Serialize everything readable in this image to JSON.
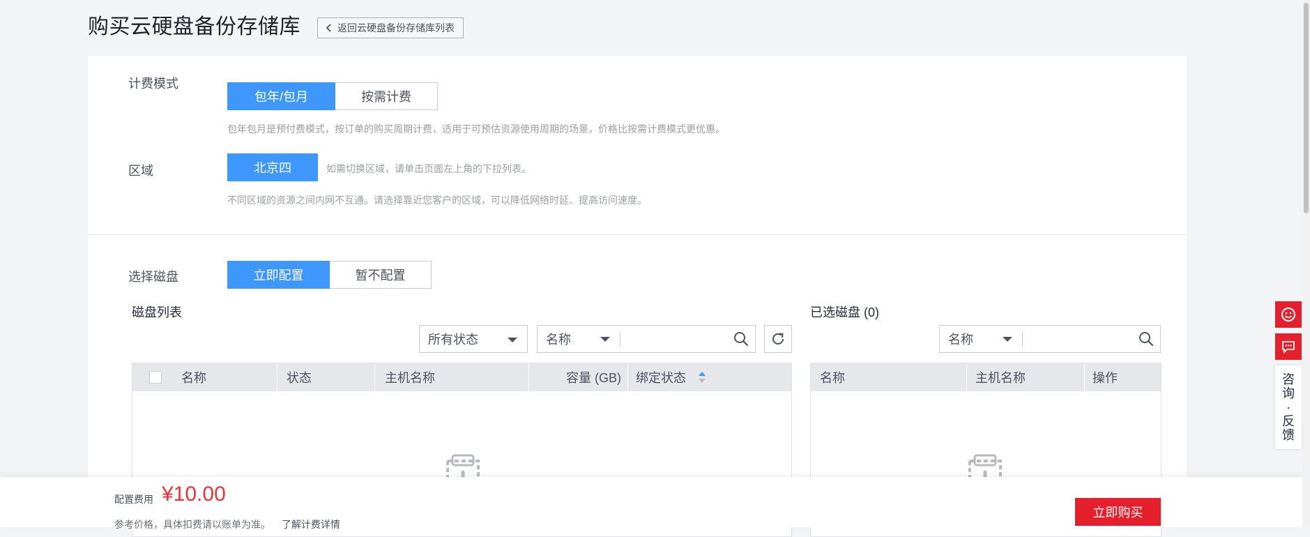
{
  "header": {
    "title": "购买云硬盘备份存储库",
    "back_label": "返回云硬盘备份存储库列表"
  },
  "billing": {
    "label": "计费模式",
    "options": [
      "包年/包月",
      "按需计费"
    ],
    "selected": "包年/包月",
    "hint": "包年包月是预付费模式，按订单的购买周期计费，适用于可预估资源使用周期的场景，价格比按需计费模式更优惠。"
  },
  "region": {
    "label": "区域",
    "value": "北京四",
    "hint_inline": "如需切换区域，请单击页面左上角的下拉列表。",
    "hint": "不同区域的资源之间内网不互通。请选择靠近您客户的区域，可以降低网络时延、提高访问速度。"
  },
  "disk_select": {
    "label": "选择磁盘",
    "options": [
      "立即配置",
      "暂不配置"
    ],
    "selected": "立即配置"
  },
  "disk_list": {
    "title": "磁盘列表",
    "status_filter": "所有状态",
    "search_field": "名称",
    "search_placeholder": "",
    "columns": [
      "名称",
      "状态",
      "主机名称",
      "容量 (GB)",
      "绑定状态"
    ]
  },
  "selected_disks": {
    "title": "已选磁盘 (0)",
    "search_field": "名称",
    "search_placeholder": "",
    "columns": [
      "名称",
      "主机名称",
      "操作"
    ]
  },
  "footer": {
    "fee_label": "配置费用",
    "fee_amount": "¥10.00",
    "note": "参考价格，具体扣费请以账单为准。",
    "note_link": "了解计费详情",
    "buy_label": "立即购买"
  },
  "float_toolbar": {
    "feedback_chars": [
      "咨",
      "询",
      "·",
      "反",
      "馈"
    ]
  },
  "colors": {
    "primary": "#3e97fb",
    "danger": "#e51f2c",
    "price": "#e8323c"
  }
}
